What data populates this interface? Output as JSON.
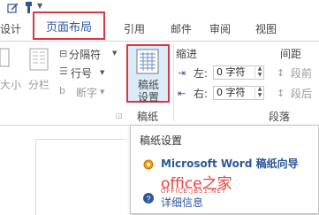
{
  "tabs": [
    "设计",
    "页面布局",
    "引用",
    "邮件",
    "审阅",
    "视图"
  ],
  "ribbon": {
    "left_labels": [
      "大小",
      "分栏"
    ],
    "fenge_label": "分隔符",
    "hanghao_label": "行号",
    "duanzi_label": "断字",
    "gaozhi_button_label_1": "稿纸",
    "gaozhi_button_label_2": "设置",
    "gaozhi_group_label": "稿纸",
    "suojin_header": "缩进",
    "left_label": "左:",
    "left_value": "0 字符",
    "right_label": "右:",
    "right_value": "0 字符",
    "jianju_header": "间距",
    "duanqian_label": "段前",
    "duanhou_label": "段后",
    "paragraph_group_label": "段落"
  },
  "tooltip": {
    "title": "稿纸设置",
    "line1": "Microsoft Word 稿纸向导",
    "line2": "详细信息"
  },
  "watermark": {
    "text": "office之家",
    "url": "OFFICE.JB51.NET"
  },
  "colors": {
    "accent": "#2b579a",
    "highlight_border": "#d9363e",
    "button_hover": "#dcebf9",
    "watermark": "#e8413c"
  }
}
